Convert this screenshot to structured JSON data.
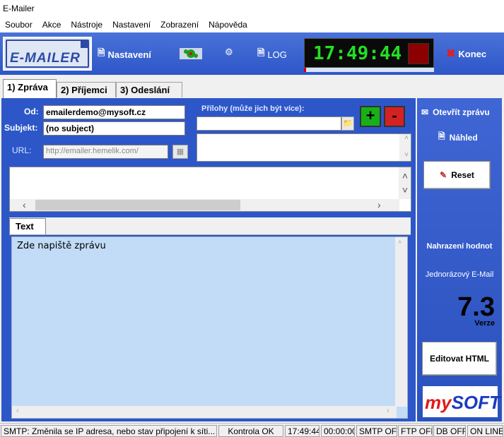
{
  "window": {
    "title": "E-Mailer"
  },
  "menu": [
    {
      "label": "Soubor"
    },
    {
      "label": "Akce"
    },
    {
      "label": "Nástroje"
    },
    {
      "label": "Nastavení"
    },
    {
      "label": "Zobrazení"
    },
    {
      "label": "Nápověda"
    }
  ],
  "toolbar": {
    "logo_text": "E-MAILER",
    "settings_label": "Nastavení",
    "log_label": "LOG",
    "clock": "17:49:44",
    "exit_label": "Konec"
  },
  "tabs": [
    {
      "label": "1) Zpráva"
    },
    {
      "label": "2) Příjemci"
    },
    {
      "label": "3) Odeslání"
    }
  ],
  "form": {
    "from_label": "Od:",
    "from_value": "emailerdemo@mysoft.cz",
    "subject_label": "Subjekt:",
    "subject_value": "(no subject)",
    "url_label": "URL:",
    "url_value": "http://emailer.hemelik.com/",
    "attachments_label": "Přílohy (může jich být více):",
    "add_label": "+",
    "remove_label": "-"
  },
  "editor": {
    "tab_label": "Text",
    "body": "Zde napiště zprávu"
  },
  "right": {
    "open_message": "Otevřít zprávu",
    "preview": "Náhled",
    "reset": "Reset",
    "replace_values": "Nahrazení hodnot",
    "single_email": "Jednorázový E-Mail",
    "version": "7.3",
    "version_label": "Verze",
    "edit_html": "Editovat HTML",
    "brand_a": "my",
    "brand_b": "SOFT"
  },
  "status": {
    "message": "SMTP: Změnila se IP adresa, nebo stav připojení k síti...",
    "check": "Kontrola OK",
    "time": "17:49:44",
    "elapsed": "00:00:00",
    "smtp": "SMTP OFF",
    "ftp": "FTP OFF",
    "db": "DB OFF",
    "online": "ON LINE"
  },
  "colors": {
    "panel": "#2d57c8",
    "message_bg": "#c2dcf7",
    "clock_digits": "#22e022"
  }
}
